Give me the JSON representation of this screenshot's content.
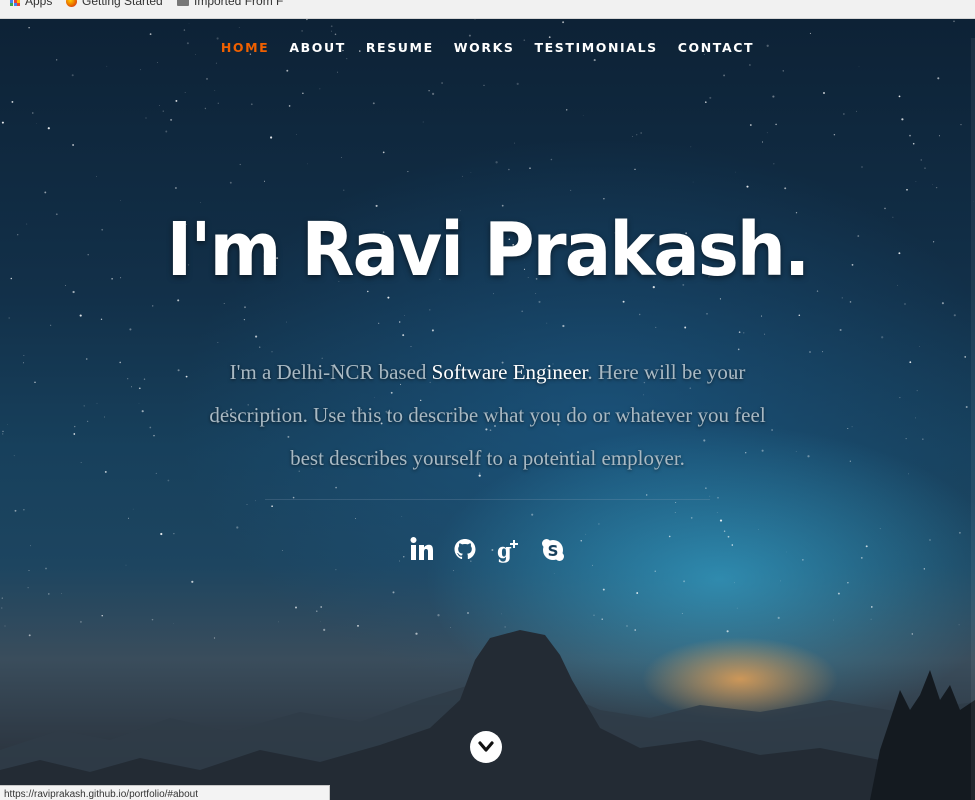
{
  "bookmarks": {
    "apps": "Apps",
    "getting_started": "Getting Started",
    "imported": "Imported From F"
  },
  "nav": {
    "items": [
      "HOME",
      "ABOUT",
      "RESUME",
      "WORKS",
      "TESTIMONIALS",
      "CONTACT"
    ],
    "active": "HOME",
    "active_color": "#f06000"
  },
  "hero": {
    "headline": "I'm Ravi Prakash.",
    "description_pre": "I'm a Delhi-NCR based ",
    "description_strong": "Software Engineer",
    "description_post": ". Here will be your description. Use this to describe what you do or whatever you feel best describes yourself to a potential employer."
  },
  "social": [
    "linkedin-icon",
    "github-icon",
    "google-plus-icon",
    "skype-icon"
  ],
  "status_bar": {
    "url": "https://raviprakash.github.io/portfolio/#about"
  }
}
